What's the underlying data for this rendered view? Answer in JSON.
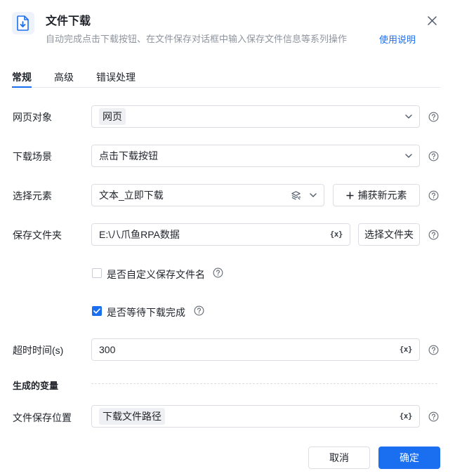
{
  "header": {
    "icon": "download-file-icon",
    "title": "文件下载",
    "subtitle": "自动完成点击下载按钮、在文件保存对话框中输入保存文件信息等系列操作",
    "help_link": "使用说明",
    "close_icon": "close-icon"
  },
  "tabs": [
    {
      "label": "常规",
      "active": true
    },
    {
      "label": "高级",
      "active": false
    },
    {
      "label": "错误处理",
      "active": false
    }
  ],
  "form": {
    "webpage_object": {
      "label": "网页对象",
      "value": "网页"
    },
    "download_scenario": {
      "label": "下载场景",
      "value": "点击下载按钮"
    },
    "select_element": {
      "label": "选择元素",
      "value": "文本_立即下载",
      "capture_button": "捕获新元素"
    },
    "save_folder": {
      "label": "保存文件夹",
      "value": "E:\\八爪鱼RPA数据",
      "choose_button": "选择文件夹"
    },
    "custom_filename": {
      "label": "是否自定义保存文件名",
      "checked": false
    },
    "wait_download": {
      "label": "是否等待下载完成",
      "checked": true
    },
    "timeout": {
      "label": "超时时间(s)",
      "value": "300"
    },
    "variable_token": "{x}"
  },
  "variables": {
    "section_title": "生成的变量",
    "file_save_location": {
      "label": "文件保存位置",
      "value": "下载文件路径"
    }
  },
  "footer": {
    "cancel": "取消",
    "confirm": "确定"
  },
  "colors": {
    "primary": "#1a6ef0",
    "border": "#dcdee3",
    "text": "#1f2329",
    "muted": "#8f959e"
  }
}
